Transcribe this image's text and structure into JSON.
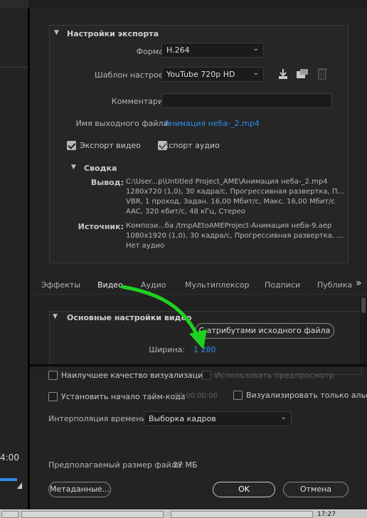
{
  "export_settings": {
    "title": "Настройки экспорта",
    "format_label": "Формат:",
    "format_value": "H.264",
    "preset_label": "Шаблон настроек:",
    "preset_value": "YouTube 720p HD",
    "comments_label": "Комментарии:",
    "comments_value": "",
    "output_label": "Имя выходного файла:",
    "output_value": "Анимация неба-_2.mp4",
    "export_video_label": "Экспорт видео",
    "export_video_checked": true,
    "export_audio_label": "Экспорт аудио",
    "export_audio_checked": true
  },
  "summary": {
    "title": "Сводка",
    "output_key": "Вывод:",
    "output_lines": [
      "C:\\User...p\\Untitled Project_AME\\Анимация неба-_2.mp4",
      "1280x720 (1,0), 30 кадра/с, Прогрессивная развертка, П...",
      "VBR, 1 проход, Задан. 16,00 Мбит/с, Макс. 16,00 Мбит/с",
      "AAC, 320 кбит/с, 48 кГц, Стерео"
    ],
    "source_key": "Источник:",
    "source_lines": [
      "Компози...ба /tmpAEtoAMEProject-Анимация неба-9.aep",
      "1080x1920 (1,0), 30 кадра/с, Прогрессивная развертка, ...",
      "Нет аудио"
    ]
  },
  "tabs": [
    {
      "label": "Эффекты"
    },
    {
      "label": "Видео"
    },
    {
      "label": "Аудио"
    },
    {
      "label": "Мультиплексор"
    },
    {
      "label": "Подписи"
    },
    {
      "label": "Публикац"
    }
  ],
  "tabs_more": "»",
  "video": {
    "title": "Основные настройки видео",
    "match_source_button": "С атрибутами исходного файла",
    "width_label": "Ширина:",
    "width_value": "1 280"
  },
  "options": {
    "best_quality_label": "Наилучшее качество визуализации",
    "best_quality_checked": false,
    "use_previews_label": "Использовать предпросмотр",
    "use_previews_checked": false,
    "start_timecode_label": "Установить начало тайм-кода",
    "start_timecode_checked": false,
    "start_timecode_value": "00:00:00:00",
    "alpha_only_label": "Визуализировать только альфа-",
    "alpha_only_checked": false,
    "time_interp_label": "Интерполяция времени:",
    "time_interp_value": "Выборка кадров",
    "estimated_size_label": "Предполагаемый размер файла:",
    "estimated_size_value": "27 МБ"
  },
  "buttons": {
    "metadata": "Метаданные...",
    "ok": "OK",
    "cancel": "Отмена"
  },
  "left_panel": {
    "timecode": "4:00"
  },
  "taskbar": {
    "clock": "17:27"
  },
  "colors": {
    "accent_link": "#2d8ceb",
    "annotation_arrow": "#1fd11f",
    "background": "#232323"
  }
}
